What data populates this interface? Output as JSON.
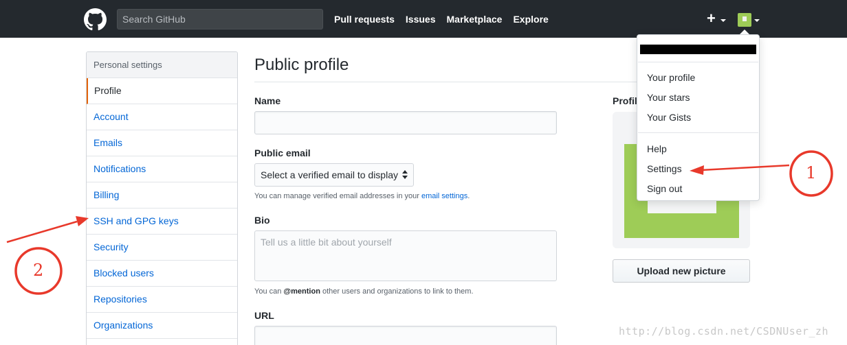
{
  "header": {
    "search_placeholder": "Search GitHub",
    "nav": [
      "Pull requests",
      "Issues",
      "Marketplace",
      "Explore"
    ],
    "plus_symbol": "+"
  },
  "sidebar": {
    "heading": "Personal settings",
    "items": [
      {
        "label": "Profile",
        "selected": true
      },
      {
        "label": "Account"
      },
      {
        "label": "Emails"
      },
      {
        "label": "Notifications"
      },
      {
        "label": "Billing"
      },
      {
        "label": "SSH and GPG keys"
      },
      {
        "label": "Security"
      },
      {
        "label": "Blocked users"
      },
      {
        "label": "Repositories"
      },
      {
        "label": "Organizations"
      }
    ]
  },
  "main": {
    "title": "Public profile",
    "name_label": "Name",
    "name_value": "",
    "public_email_label": "Public email",
    "public_email_select": "Select a verified email to display",
    "public_email_note_prefix": "You can manage verified email addresses in your ",
    "public_email_note_link": "email settings",
    "public_email_note_suffix": ".",
    "bio_label": "Bio",
    "bio_placeholder": "Tell us a little bit about yourself",
    "bio_note_prefix": "You can ",
    "bio_note_mention": "@mention",
    "bio_note_suffix": " other users and organizations to link to them.",
    "url_label": "URL"
  },
  "profile_picture": {
    "label": "Profile",
    "upload_button": "Upload new picture",
    "identicon_color": "#9ecc57"
  },
  "dropdown": {
    "group1": [
      "Your profile",
      "Your stars",
      "Your Gists"
    ],
    "group2": [
      "Help",
      "Settings",
      "Sign out"
    ]
  },
  "annotations": {
    "one": "1",
    "two": "2",
    "color": "#e8392b"
  },
  "watermark": "http://blog.csdn.net/CSDNUser_zh",
  "colors": {
    "header_bg": "#24292e",
    "link": "#0366d6",
    "selected_accent": "#e36209"
  }
}
